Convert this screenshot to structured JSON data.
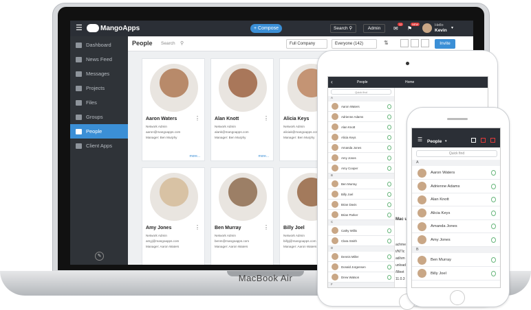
{
  "laptop": {
    "brand": "MacBook Air",
    "app_name": "MangoApps",
    "compose_label": "+ Compose",
    "search_label": "Search",
    "admin_label": "Admin",
    "notif_count_1": "12",
    "notif_count_2": "NEW",
    "greeting": "Hello",
    "user_name": "Kevin",
    "sidebar": [
      {
        "label": "Dashboard",
        "active": false
      },
      {
        "label": "News Feed",
        "active": false
      },
      {
        "label": "Messages",
        "active": false
      },
      {
        "label": "Projects",
        "active": false
      },
      {
        "label": "Files",
        "active": false
      },
      {
        "label": "Groups",
        "active": false
      },
      {
        "label": "People",
        "active": true
      },
      {
        "label": "Client Apps",
        "active": false
      }
    ],
    "page_title": "People",
    "search_placeholder": "Search",
    "filter_company": "Full Company",
    "filter_everyone": "Everyone (142)",
    "invite_label": "Invite",
    "cards": [
      {
        "name": "Aaron Waters",
        "role": "Network Admin",
        "email": "aaron@mangoapps.com",
        "manager": "Manager: Ben Murphy",
        "more": "more..."
      },
      {
        "name": "Alan Knott",
        "role": "Network Admin",
        "email": "alank@mangoapps.com",
        "manager": "Manager: Ben Murphy",
        "more": "more..."
      },
      {
        "name": "Alicia Keys",
        "role": "Network Admin",
        "email": "aliciak@mangoapps.com",
        "manager": "Manager: Ben Murphy",
        "more": ""
      },
      {
        "name": "Amy Jones",
        "role": "Network Admin",
        "email": "amyj@mangoapps.com",
        "manager": "Manager: Aaron Waters",
        "more": ""
      },
      {
        "name": "Ben Murray",
        "role": "Network Admin",
        "email": "benm@mangoapps.com",
        "manager": "Manager: Aaron Waters",
        "more": ""
      },
      {
        "name": "Billy Joel",
        "role": "Network Admin",
        "email": "billyj@mangoapps.com",
        "manager": "Manager: Aaron Waters",
        "more": ""
      }
    ]
  },
  "tablet": {
    "header_title": "People",
    "home_label": "Home",
    "quick_find": "Quick find",
    "sections": [
      {
        "letter": "A",
        "people": [
          "Aaron Waters",
          "Adrienne Adams",
          "Alan Knott",
          "Alicia Keys",
          "Amanda Jones",
          "Amy Jones",
          "Amy Cooper"
        ]
      },
      {
        "letter": "B",
        "people": [
          "Ben Murray",
          "Billy Joel",
          "Brian Davis",
          "Brian Parker"
        ]
      },
      {
        "letter": "C",
        "people": [
          "Cathy Willis",
          "Clara Smith"
        ]
      },
      {
        "letter": "D",
        "people": [
          "Dennis Miller",
          "Donald Jorgensen",
          "Drew Watson"
        ]
      },
      {
        "letter": "F",
        "people": []
      }
    ],
    "side_text": [
      "Mac u",
      "achme",
      "t/NTIc",
      "ad/sm",
      "unload",
      "/Meet",
      "11.0.3"
    ]
  },
  "phone": {
    "header_title": "People",
    "quick_find": "Quick find",
    "sections": [
      {
        "letter": "A",
        "people": [
          "Aaron Waters",
          "Adrienne Adams",
          "Alan Knott",
          "Alicia Keys",
          "Amanda Jones",
          "Amy Jones"
        ]
      },
      {
        "letter": "B",
        "people": [
          "Ben Murray",
          "Billy Joel"
        ]
      }
    ]
  },
  "colors": {
    "accent": "#3b8fd6",
    "topbar": "#2b2f36",
    "sidebar": "#2f3338"
  }
}
